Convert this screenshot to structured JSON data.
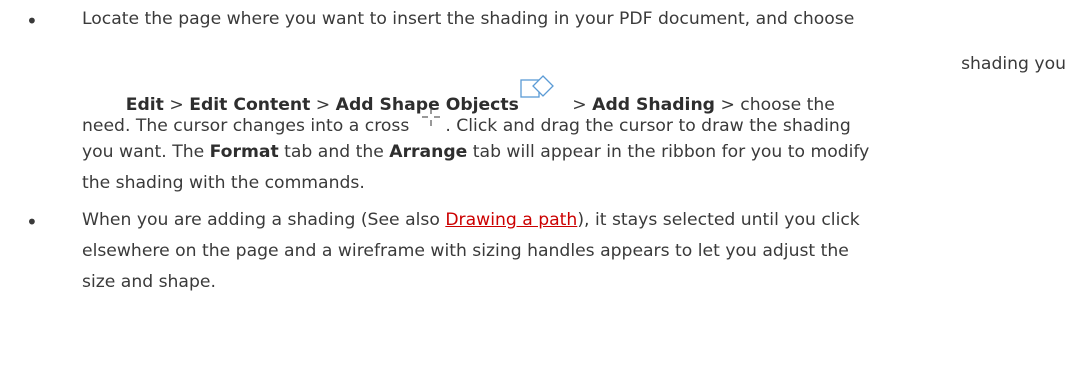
{
  "bullets": [
    {
      "symbol": "•",
      "line1": "Locate the page where you want to insert the shading in your PDF document, and choose",
      "line2": {
        "edit": "Edit",
        "sep1": " > ",
        "edit_content": "Edit Content",
        "sep2": " > ",
        "add_shape_objects": "Add Shape Objects",
        "sep3": " > ",
        "add_shading": "Add Shading",
        "tail_a": " > choose the",
        "tail_b": "shading you"
      },
      "line3": {
        "before_icon": "need. The cursor changes into a cross",
        "after_icon": ". Click and drag the cursor to draw the shading"
      },
      "line4": {
        "text_a": "you want. The ",
        "format": "Format",
        "text_b": " tab and the ",
        "arrange": "Arrange",
        "text_c": " tab will appear in the ribbon for you to modify"
      },
      "line5": "the shading with the commands."
    },
    {
      "symbol": "•",
      "line1": {
        "text_a": "When you are adding a shading (See also ",
        "link": "Drawing a path",
        "text_b": "), it stays selected until you click"
      },
      "line2": "elsewhere on the page and a wireframe with sizing handles appears to let you adjust the",
      "line3": "size and shape."
    }
  ],
  "icons": {
    "shape_objects_icon": "shape-objects-icon",
    "cross_cursor_icon": "cross-cursor-icon"
  },
  "colors": {
    "text": "#3a3a3a",
    "link": "#cc0000",
    "icon_stroke": "#5b9bd5"
  }
}
